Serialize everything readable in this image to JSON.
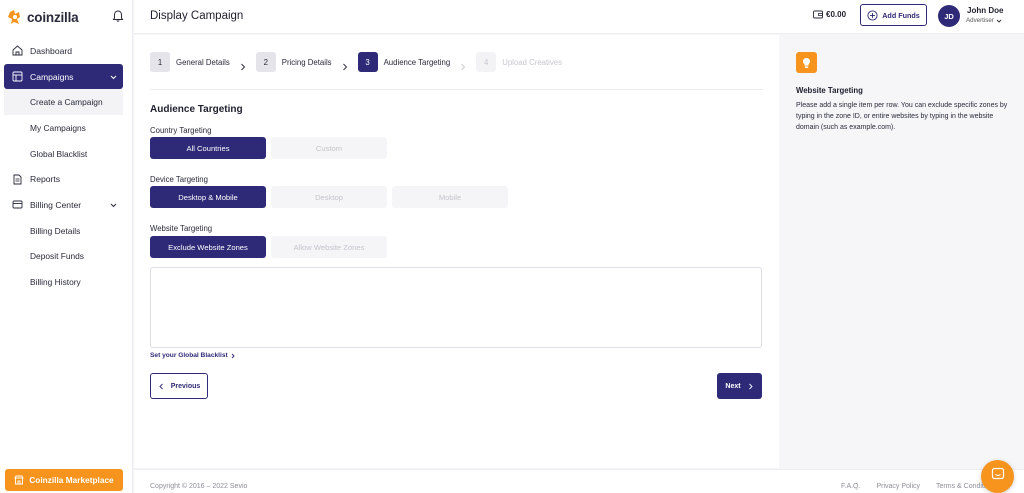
{
  "brand": {
    "name": "coinzilla",
    "accent": "#2e2a78",
    "orange": "#f7941d"
  },
  "sidebar": {
    "items": [
      {
        "label": "Dashboard",
        "icon": "home-icon"
      },
      {
        "label": "Campaigns",
        "icon": "layout-icon",
        "active": true
      },
      {
        "label": "Create a Campaign",
        "sub": true,
        "selected": true
      },
      {
        "label": "My Campaigns",
        "sub": true
      },
      {
        "label": "Global Blacklist",
        "sub": true
      },
      {
        "label": "Reports",
        "icon": "document-icon"
      },
      {
        "label": "Billing Center",
        "icon": "credit-card-icon"
      },
      {
        "label": "Billing Details",
        "sub": true
      },
      {
        "label": "Deposit Funds",
        "sub": true
      },
      {
        "label": "Billing History",
        "sub": true
      }
    ],
    "marketplace_label": "Coinzilla Marketplace"
  },
  "header": {
    "title": "Display Campaign",
    "balance": "€0.00",
    "add_funds_label": "Add Funds",
    "user": {
      "initials": "JD",
      "name": "John Doe",
      "role": "Advertiser"
    }
  },
  "steps": [
    {
      "num": "1",
      "label": "General Details",
      "state": "done"
    },
    {
      "num": "2",
      "label": "Pricing Details",
      "state": "done"
    },
    {
      "num": "3",
      "label": "Audience Targeting",
      "state": "active"
    },
    {
      "num": "4",
      "label": "Upload Creatives",
      "state": "pending"
    }
  ],
  "form": {
    "section_title": "Audience Targeting",
    "country": {
      "label": "Country Targeting",
      "options": [
        "All Countries",
        "Custom"
      ],
      "selected": "All Countries"
    },
    "device": {
      "label": "Device Targeting",
      "options": [
        "Desktop & Mobile",
        "Desktop",
        "Mobile"
      ],
      "selected": "Desktop & Mobile"
    },
    "website": {
      "label": "Website Targeting",
      "options": [
        "Exclude Website Zones",
        "Allow Website Zones"
      ],
      "selected": "Exclude Website Zones"
    },
    "zones_value": "",
    "blacklist_link": "Set your Global Blacklist",
    "previous_label": "Previous",
    "next_label": "Next"
  },
  "tip": {
    "title": "Website Targeting",
    "body": "Please add a single item per row. You can exclude specific zones by typing in the zone ID, or entire websites by typing in the website domain (such as example.com)."
  },
  "footer": {
    "copyright": "Copyright © 2016 – 2022 Sevio",
    "links": [
      "F.A.Q.",
      "Privacy Policy",
      "Terms & Conditions"
    ]
  }
}
